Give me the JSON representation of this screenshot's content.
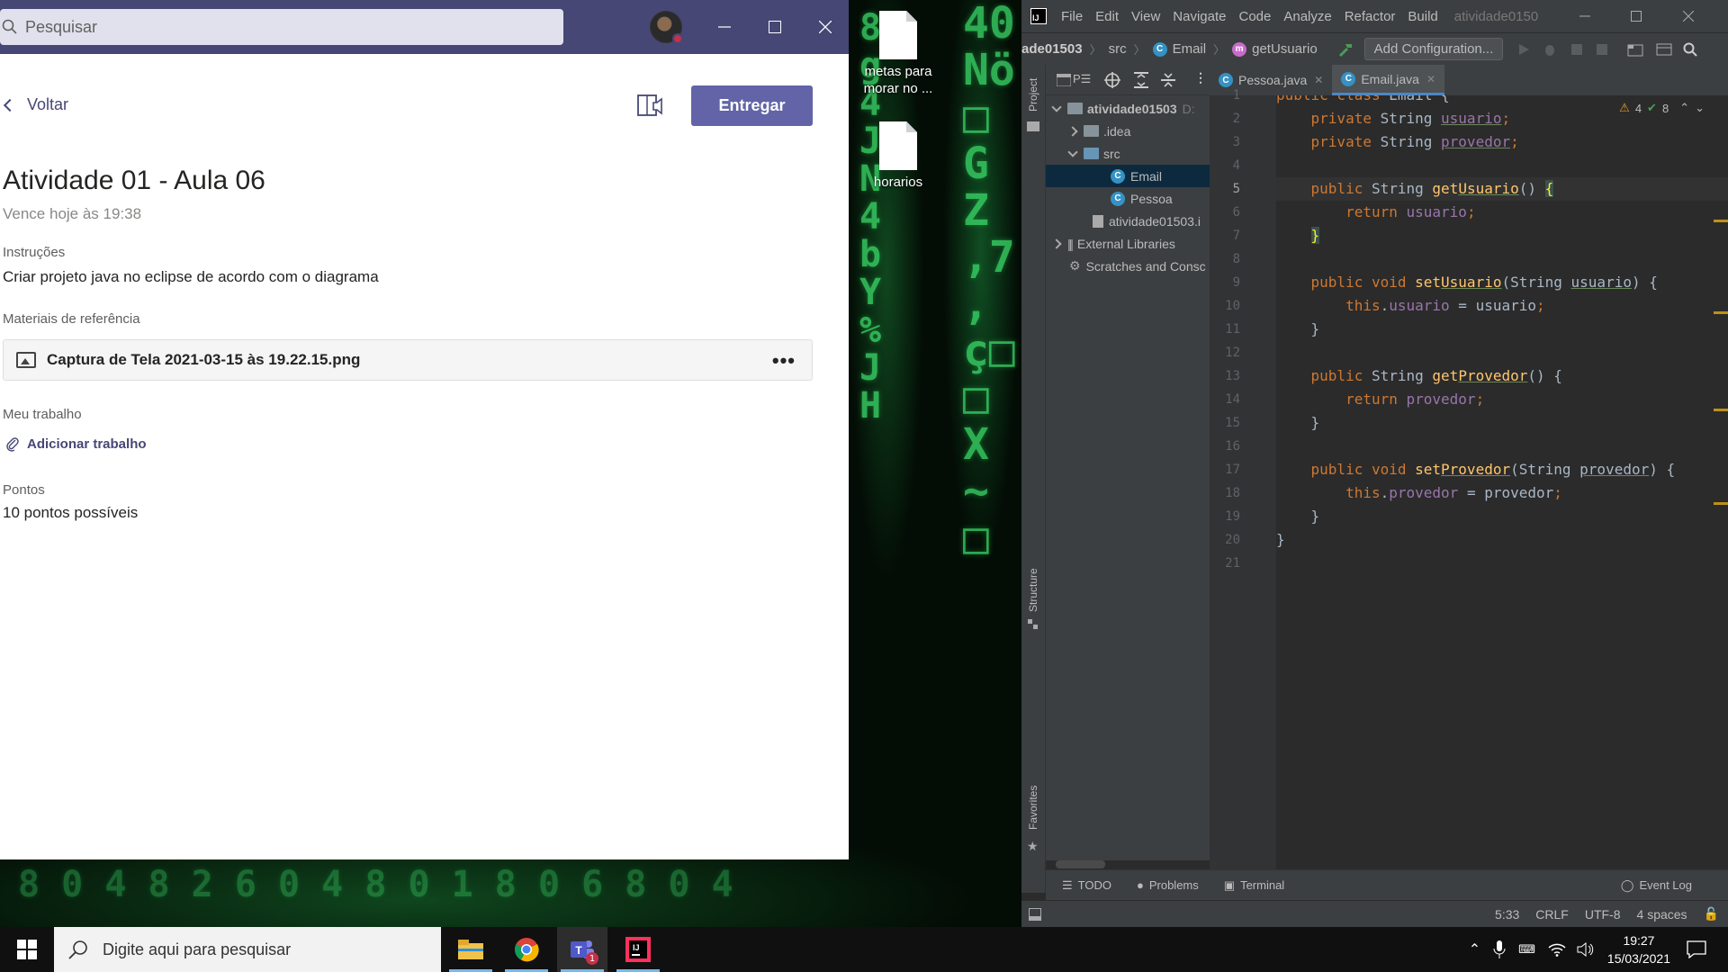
{
  "teams": {
    "search_placeholder": "Pesquisar",
    "back_label": "Voltar",
    "submit_label": "Entregar",
    "assignment_title": "Atividade 01 - Aula 06",
    "due_text": "Vence hoje às 19:38",
    "instructions_label": "Instruções",
    "instructions_text": "Criar projeto java no eclipse de acordo com o diagrama",
    "reference_label": "Materiais de referência",
    "attachment_name": "Captura de Tela 2021-03-15 às 19.22.15.png",
    "my_work_label": "Meu trabalho",
    "add_work_label": "Adicionar trabalho",
    "points_label": "Pontos",
    "points_text": "10 pontos possíveis"
  },
  "desktop": {
    "icons": [
      {
        "label_line1": "metas para",
        "label_line2": "morar no ..."
      },
      {
        "label_line1": "horarios",
        "label_line2": ""
      }
    ]
  },
  "intellij": {
    "menu": [
      "File",
      "Edit",
      "View",
      "Navigate",
      "Code",
      "Analyze",
      "Refactor",
      "Build"
    ],
    "window_title": "atividade0150",
    "breadcrumb": {
      "project": "ade01503",
      "src": "src",
      "class": "Email",
      "method": "getUsuario"
    },
    "add_configuration": "Add Configuration...",
    "tool_window_project": "Project",
    "tool_window_structure": "Structure",
    "tool_window_favorites": "Favorites",
    "project_toolbar_label": "P☰",
    "tree": {
      "root": "atividade01503",
      "root_path": "D:",
      "idea": ".idea",
      "src": "src",
      "email": "Email",
      "pessoa": "Pessoa",
      "iml": "atividade01503.i",
      "external": "External Libraries",
      "scratches": "Scratches and Consc"
    },
    "tabs": [
      {
        "label": "Pessoa.java"
      },
      {
        "label": "Email.java"
      }
    ],
    "inspections": {
      "warnings": "4",
      "ok": "8"
    },
    "line_numbers": [
      "1",
      "2",
      "3",
      "4",
      "5",
      "6",
      "7",
      "8",
      "9",
      "10",
      "11",
      "12",
      "13",
      "14",
      "15",
      "16",
      "17",
      "18",
      "19",
      "20",
      "21"
    ],
    "bottom_tabs": {
      "todo": "TODO",
      "problems": "Problems",
      "terminal": "Terminal",
      "event_log": "Event Log"
    },
    "status": {
      "position": "5:33",
      "line_sep": "CRLF",
      "encoding": "UTF-8",
      "indent": "4 spaces"
    }
  },
  "taskbar": {
    "search_placeholder": "Digite aqui para pesquisar",
    "time": "19:27",
    "date": "15/03/2021",
    "teams_badge": "1"
  }
}
